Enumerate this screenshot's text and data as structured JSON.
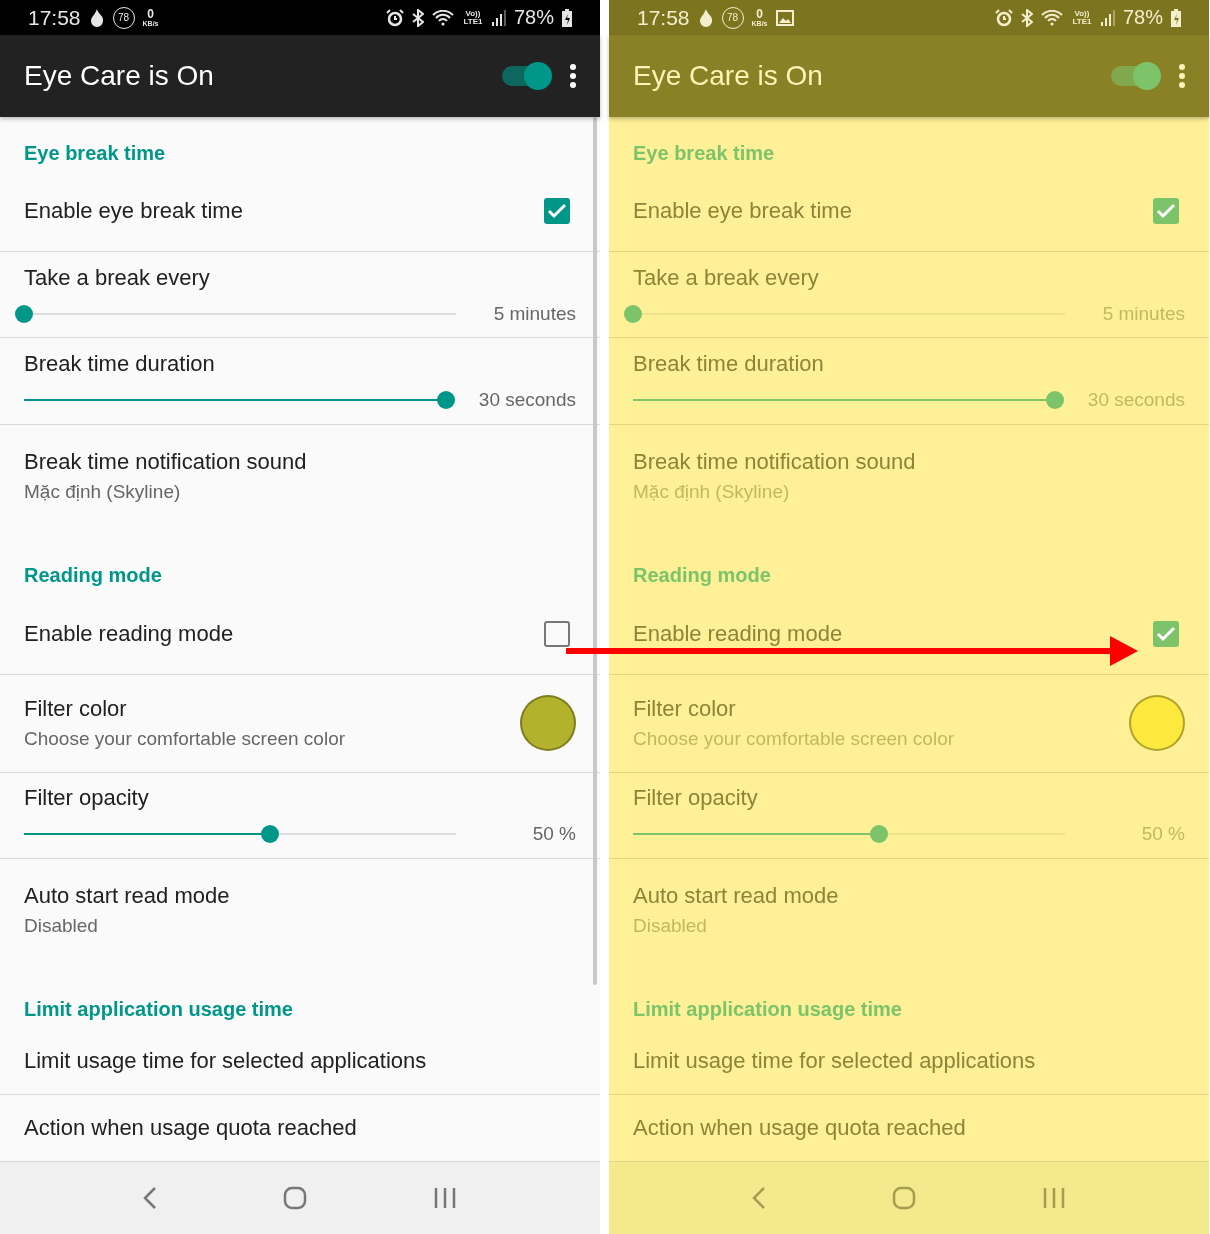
{
  "screens": [
    {
      "filter_on": false,
      "status_bar": {
        "time": "17:58",
        "badge": "78",
        "speed_value": "0",
        "speed_unit": "KB/s",
        "image_notification": false,
        "network": "Vo)) LTE1",
        "battery": "78%"
      },
      "app_bar": {
        "title": "Eye Care is On",
        "switch_on": true
      },
      "sections": [
        {
          "title": "Eye break time",
          "items": [
            {
              "kind": "checkbox",
              "title": "Enable eye break time",
              "checked": true
            },
            {
              "kind": "slider",
              "title": "Take a break every",
              "level": 0,
              "reading": "5 minutes"
            },
            {
              "kind": "slider",
              "title": "Break time duration",
              "level": 1,
              "reading": "30 seconds"
            },
            {
              "kind": "text",
              "title": "Break time notification sound",
              "summary": "Mặc định (Skyline)"
            }
          ]
        },
        {
          "title": "Reading mode",
          "items": [
            {
              "kind": "checkbox",
              "title": "Enable reading mode",
              "checked": false
            },
            {
              "kind": "color",
              "title": "Filter color",
              "summary": "Choose your comfortable screen color",
              "color": "#b3b22c"
            },
            {
              "kind": "slider",
              "title": "Filter opacity",
              "level": 0.57,
              "reading": "50 %"
            },
            {
              "kind": "text",
              "title": "Auto start read mode",
              "summary": "Disabled"
            }
          ]
        },
        {
          "title": "Limit application usage time",
          "items": [
            {
              "kind": "plain",
              "title": "Limit usage time for selected applications"
            },
            {
              "kind": "plain",
              "title": "Action when usage quota reached"
            }
          ]
        }
      ]
    },
    {
      "filter_on": true,
      "status_bar": {
        "time": "17:58",
        "badge": "78",
        "speed_value": "0",
        "speed_unit": "KB/s",
        "image_notification": true,
        "network": "Vo)) LTE1",
        "battery": "78%"
      },
      "app_bar": {
        "title": "Eye Care is On",
        "switch_on": true
      },
      "sections": [
        {
          "title": "Eye break time",
          "items": [
            {
              "kind": "checkbox",
              "title": "Enable eye break time",
              "checked": true
            },
            {
              "kind": "slider",
              "title": "Take a break every",
              "level": 0,
              "reading": "5 minutes"
            },
            {
              "kind": "slider",
              "title": "Break time duration",
              "level": 1,
              "reading": "30 seconds"
            },
            {
              "kind": "text",
              "title": "Break time notification sound",
              "summary": "Mặc định (Skyline)"
            }
          ]
        },
        {
          "title": "Reading mode",
          "items": [
            {
              "kind": "checkbox",
              "title": "Enable reading mode",
              "checked": true
            },
            {
              "kind": "color",
              "title": "Filter color",
              "summary": "Choose your comfortable screen color",
              "color": "#fde83d"
            },
            {
              "kind": "slider",
              "title": "Filter opacity",
              "level": 0.57,
              "reading": "50 %"
            },
            {
              "kind": "text",
              "title": "Auto start read mode",
              "summary": "Disabled"
            }
          ]
        },
        {
          "title": "Limit application usage time",
          "items": [
            {
              "kind": "plain",
              "title": "Limit usage time for selected applications"
            },
            {
              "kind": "plain",
              "title": "Action when usage quota reached"
            }
          ]
        }
      ]
    }
  ]
}
